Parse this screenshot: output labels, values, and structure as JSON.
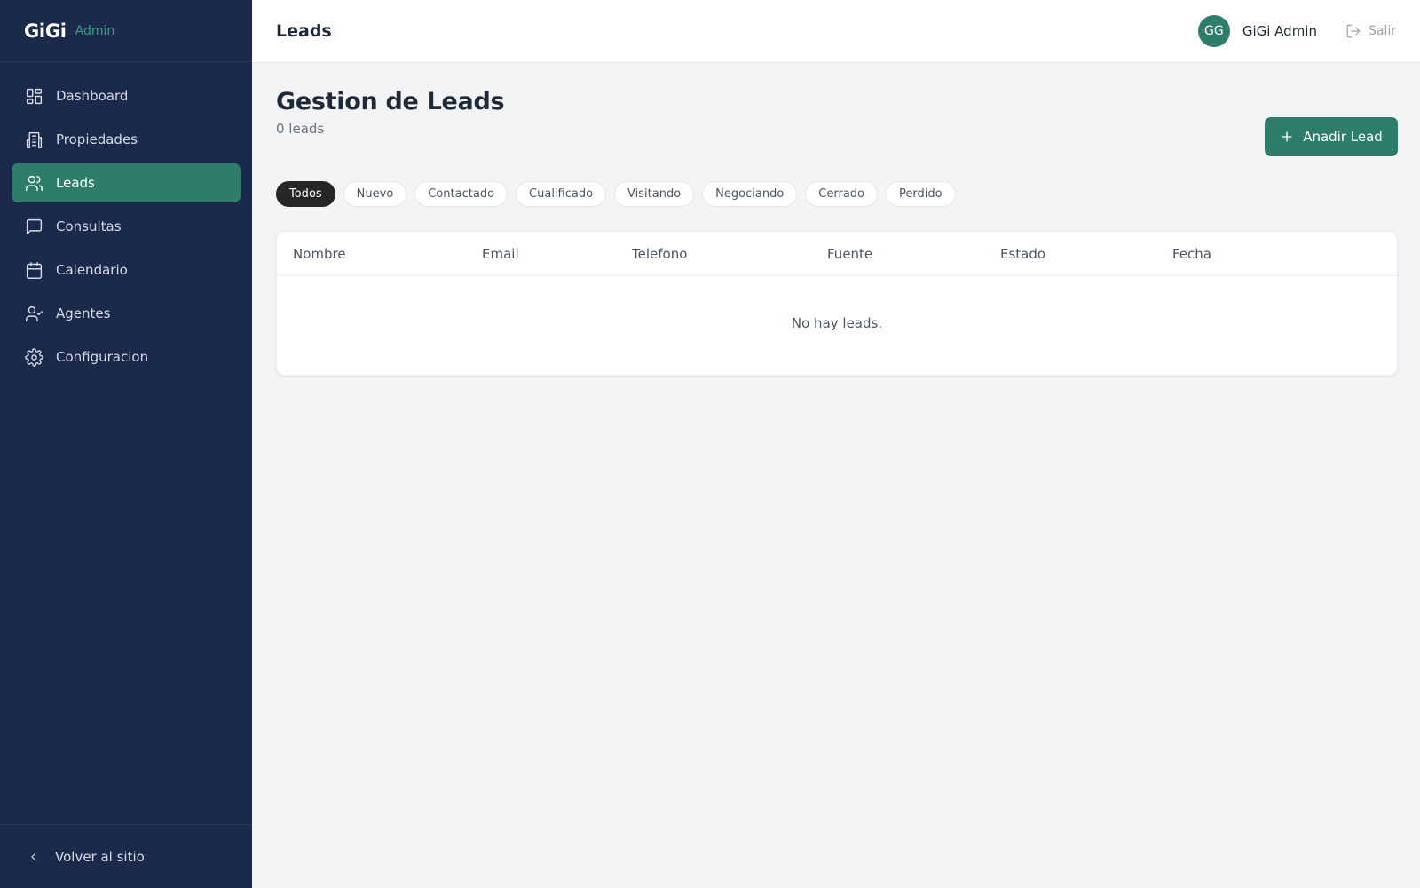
{
  "brand": {
    "name": "GiGi",
    "tag": "Admin"
  },
  "sidebar": {
    "items": [
      {
        "label": "Dashboard",
        "icon": "dashboard-grid-icon"
      },
      {
        "label": "Propiedades",
        "icon": "building-icon"
      },
      {
        "label": "Leads",
        "icon": "users-icon",
        "active": true
      },
      {
        "label": "Consultas",
        "icon": "chat-icon"
      },
      {
        "label": "Calendario",
        "icon": "calendar-icon"
      },
      {
        "label": "Agentes",
        "icon": "user-check-icon"
      },
      {
        "label": "Configuracion",
        "icon": "gear-icon"
      }
    ],
    "footer_label": "Volver al sitio"
  },
  "topbar": {
    "title": "Leads",
    "avatar_initials": "GG",
    "user_name": "GiGi Admin",
    "logout_label": "Salir"
  },
  "page": {
    "title": "Gestion de Leads",
    "count": "0 leads",
    "add_button_label": "Anadir Lead"
  },
  "filters": [
    "Todos",
    "Nuevo",
    "Contactado",
    "Cualificado",
    "Visitando",
    "Negociando",
    "Cerrado",
    "Perdido"
  ],
  "filters_active": "Todos",
  "table": {
    "columns": [
      "Nombre",
      "Email",
      "Telefono",
      "Fuente",
      "Estado",
      "Fecha"
    ],
    "rows": [],
    "empty_message": "No hay leads."
  },
  "colors": {
    "sidebar_bg": "#1b2a4a",
    "accent": "#2e7d6b",
    "active_chip": "#262626"
  }
}
